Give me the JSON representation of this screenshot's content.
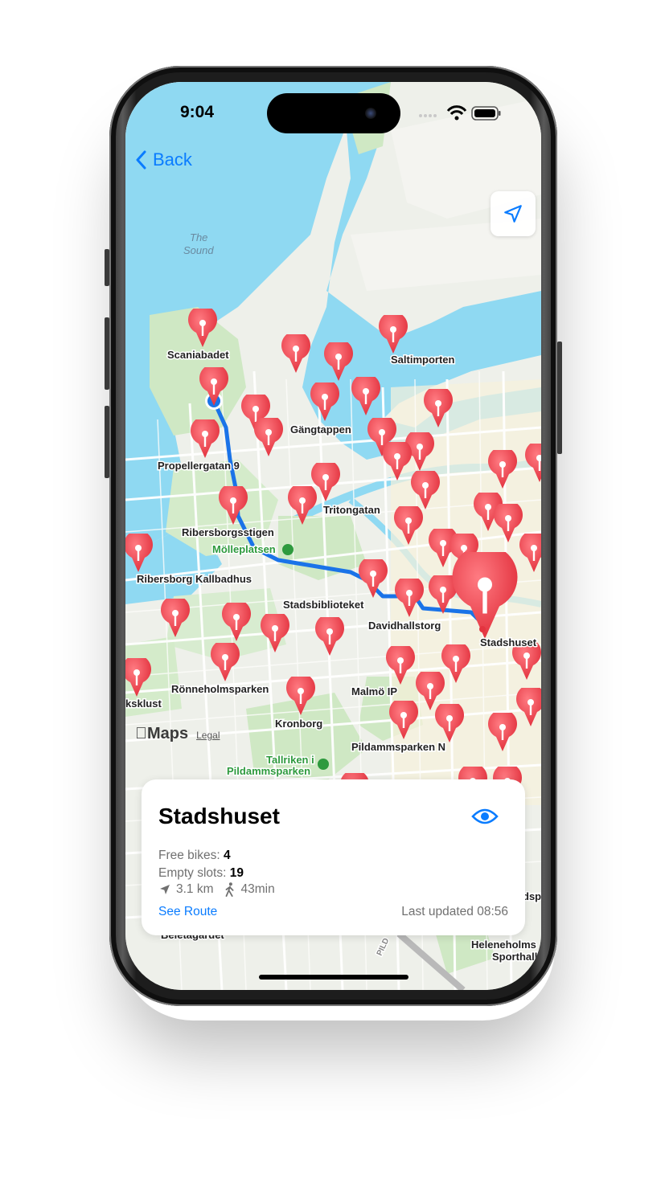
{
  "status_bar": {
    "time": "9:04"
  },
  "nav": {
    "back_label": "Back"
  },
  "map": {
    "water_label_line1": "The",
    "water_label_line2": "Sound",
    "labels": [
      "Scaniabadet",
      "Saltimporten",
      "Gängtappen",
      "Propellergatan 9",
      "Tritongatan",
      "Ribersborgsstigen",
      "Ribersborg Kallbadhus",
      "Stadsbiblioteket",
      "Davidhallstorg",
      "Stadshuset",
      "Rönneholmsparken",
      "Malmö IP",
      "Kronborg",
      "Pildammsparken N",
      "ksklust",
      "Heleneholms",
      "Sporthall",
      "dsp",
      "PILD",
      "Beletagardet"
    ],
    "poi_labels": [
      "Mölleplatsen",
      "Tallriken i",
      "Pildammsparken"
    ],
    "attribution": {
      "brand": "Maps",
      "legal": "Legal"
    }
  },
  "card": {
    "title": "Stadshuset",
    "free_bikes_label": "Free bikes:",
    "free_bikes": "4",
    "empty_slots_label": "Empty slots:",
    "empty_slots": "19",
    "distance": "3.1 km",
    "walk_time": "43min",
    "see_route": "See Route",
    "last_updated": "Last updated 08:56"
  },
  "colors": {
    "accent": "#0a7cff",
    "pin": "#e8404a",
    "route": "#1a73e8",
    "water": "#8fd9f2"
  }
}
